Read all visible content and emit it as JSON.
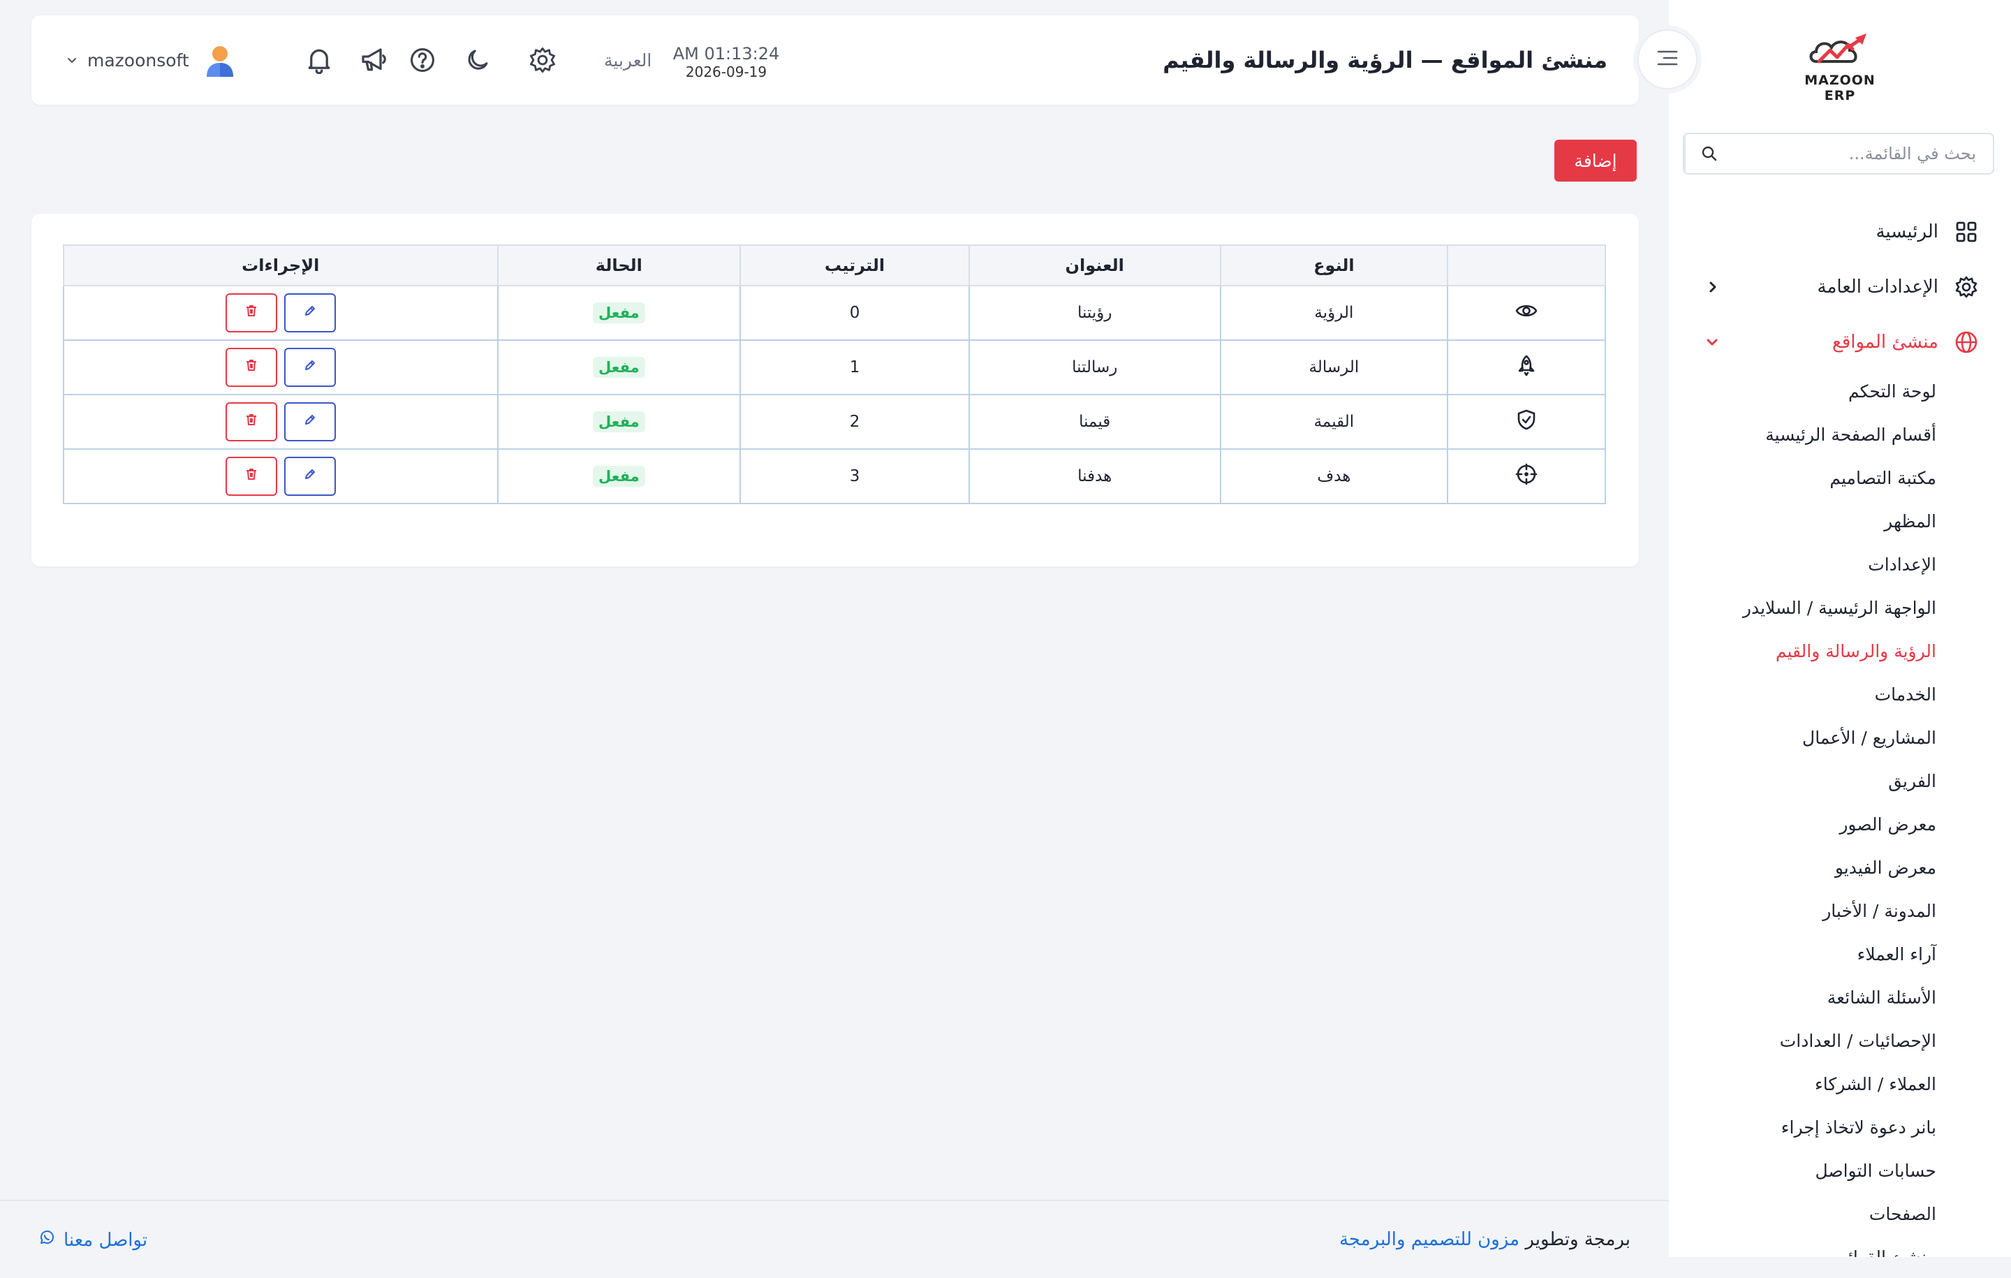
{
  "sidebar": {
    "logo_text": "MAZOON ERP",
    "search_placeholder": "بحث في القائمة...",
    "items": [
      {
        "label": "الرئيسية",
        "icon": "dashboard-grid-icon"
      },
      {
        "label": "الإعدادات العامة",
        "icon": "gear-icon"
      },
      {
        "label": "منشئ المواقع",
        "icon": "globe-icon"
      }
    ],
    "submenu": [
      "لوحة التحكم",
      "أقسام الصفحة الرئيسية",
      "مكتبة التصاميم",
      "المظهر",
      "الإعدادات",
      "الواجهة الرئيسية / السلايدر",
      "الرؤية والرسالة والقيم",
      "الخدمات",
      "المشاريع / الأعمال",
      "الفريق",
      "معرض الصور",
      "معرض الفيديو",
      "المدونة / الأخبار",
      "آراء العملاء",
      "الأسئلة الشائعة",
      "الإحصائيات / العدادات",
      "العملاء / الشركاء",
      "بانر دعوة لاتخاذ إجراء",
      "حسابات التواصل",
      "الصفحات",
      "منشئ القوائم"
    ],
    "active_sub_index": 6
  },
  "header": {
    "title": "منشئ المواقع — الرؤية والرسالة والقيم",
    "time": "AM 01:13:24",
    "date": "2026-09-19",
    "language": "العربية",
    "username": "mazoonsoft"
  },
  "toolbar": {
    "add_label": "إضافة"
  },
  "table": {
    "headers": [
      "",
      "النوع",
      "العنوان",
      "الترتيب",
      "الحالة",
      "الإجراءات"
    ],
    "rows": [
      {
        "icon": "eye-icon",
        "type": "الرؤية",
        "title": "رؤيتنا",
        "order": "0",
        "status": "مفعل"
      },
      {
        "icon": "rocket-icon",
        "type": "الرسالة",
        "title": "رسالتنا",
        "order": "1",
        "status": "مفعل"
      },
      {
        "icon": "shield-icon",
        "type": "القيمة",
        "title": "قيمنا",
        "order": "2",
        "status": "مفعل"
      },
      {
        "icon": "target-icon",
        "type": "هدف",
        "title": "هدفنا",
        "order": "3",
        "status": "مفعل"
      }
    ]
  },
  "footer": {
    "credit_prefix": "برمجة وتطوير",
    "credit_link": "مزون للتصميم والبرمجة",
    "contact": "تواصل معنا"
  },
  "colors": {
    "accent": "#e63946",
    "edit": "#3b57c9",
    "success": "#20b15a",
    "link": "#1e6fd9"
  }
}
